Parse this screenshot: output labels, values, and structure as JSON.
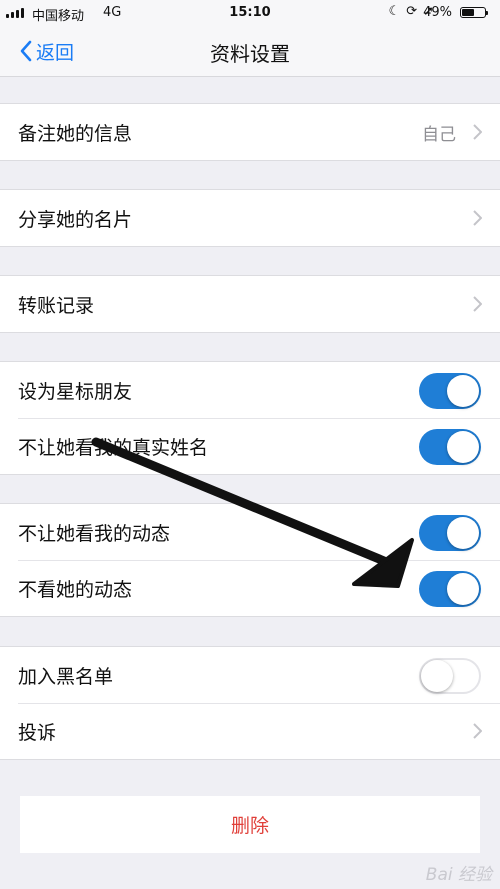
{
  "status_bar": {
    "carrier": "中国移动",
    "network": "4G",
    "time": "15:10",
    "icons": [
      "moon-icon",
      "orientation-lock-icon",
      "location-icon"
    ],
    "battery_percent": "49%",
    "battery_level": 0.49
  },
  "nav": {
    "back_label": "返回",
    "title": "资料设置"
  },
  "rows": {
    "remark": {
      "label": "备注她的信息",
      "detail": "自己"
    },
    "share_card": {
      "label": "分享她的名片"
    },
    "transfer": {
      "label": "转账记录"
    },
    "star_friend": {
      "label": "设为星标朋友",
      "enabled": true
    },
    "hide_real_name": {
      "label": "不让她看我的真实姓名",
      "enabled": true
    },
    "hide_my_moments": {
      "label": "不让她看我的动态",
      "enabled": true
    },
    "hide_her_moments": {
      "label": "不看她的动态",
      "enabled": true
    },
    "blacklist": {
      "label": "加入黑名单",
      "enabled": false
    },
    "report": {
      "label": "投诉"
    }
  },
  "delete_label": "删除",
  "watermark": "Bai 经验",
  "colors": {
    "accent": "#1f7ed6",
    "link": "#1a7cf5",
    "danger": "#e0403a",
    "background": "#efeff4"
  }
}
